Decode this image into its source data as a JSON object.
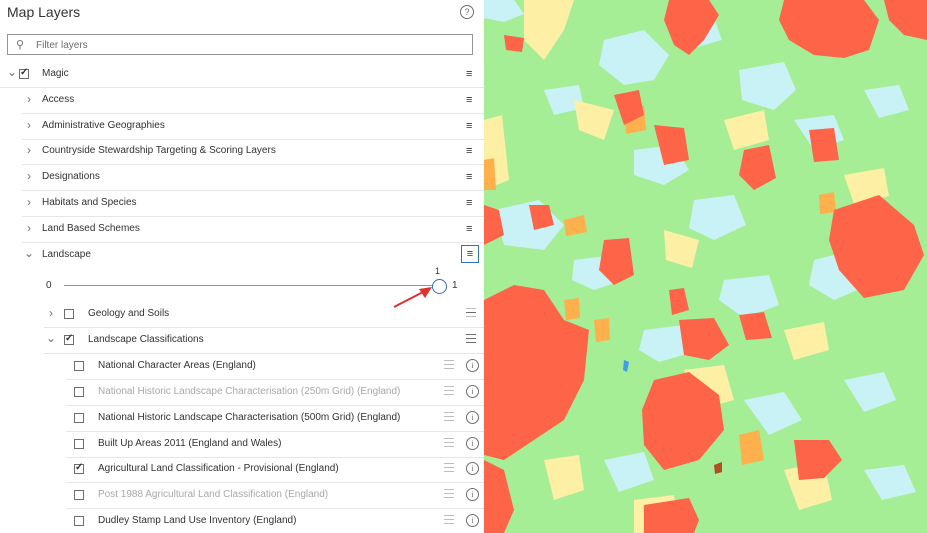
{
  "panel": {
    "title": "Map Layers",
    "help_glyph": "?",
    "filter": {
      "placeholder": "Filter layers",
      "value": ""
    }
  },
  "icons": {
    "expanded": "chevron-down-icon",
    "collapsed": "chevron-right-icon",
    "options": "sliders-icon",
    "legend": "list-icon",
    "info": "info-icon",
    "search": "search-icon"
  },
  "rows": [
    {
      "label": "Magic",
      "level": 0,
      "expand": "down",
      "check": true,
      "action": "options"
    },
    {
      "label": "Access",
      "level": 1,
      "expand": "right",
      "action": "options"
    },
    {
      "label": "Administrative Geographies",
      "level": 1,
      "expand": "right",
      "action": "options"
    },
    {
      "label": "Countryside Stewardship Targeting & Scoring Layers",
      "level": 1,
      "expand": "right",
      "action": "options"
    },
    {
      "label": "Designations",
      "level": 1,
      "expand": "right",
      "action": "options"
    },
    {
      "label": "Habitats and Species",
      "level": 1,
      "expand": "right",
      "action": "options"
    },
    {
      "label": "Land Based Schemes",
      "level": 1,
      "expand": "right",
      "action": "options"
    },
    {
      "label": "Landscape",
      "level": 1,
      "expand": "down",
      "action": "options",
      "active": true
    }
  ],
  "slider": {
    "min": "0",
    "max": "1",
    "value": "1"
  },
  "sub_rows": [
    {
      "label": "Geology and Soils",
      "level": 2,
      "expand": "right",
      "check": false,
      "action": "legend-light"
    },
    {
      "label": "Landscape Classifications",
      "level": 2,
      "expand": "down",
      "check": true,
      "action": "legend"
    },
    {
      "label": "National Character Areas (England)",
      "level": 3,
      "check": false,
      "dim": false
    },
    {
      "label": "National Historic Landscape Characterisation (250m Grid) (England)",
      "level": 3,
      "check": false,
      "dim": true
    },
    {
      "label": "National Historic Landscape Characterisation (500m Grid) (England)",
      "level": 3,
      "check": false,
      "dim": false
    },
    {
      "label": "Built Up Areas 2011 (England and Wales)",
      "level": 3,
      "check": false,
      "dim": false
    },
    {
      "label": "Agricultural Land Classification - Provisional (England)",
      "level": 3,
      "check": true,
      "dim": false
    },
    {
      "label": "Post 1988 Agricultural Land Classification (England)",
      "level": 3,
      "check": false,
      "dim": true
    },
    {
      "label": "Dudley Stamp Land Use Inventory (England)",
      "level": 3,
      "check": false,
      "dim": false
    }
  ],
  "colors": {
    "map_background": "#a5ee95",
    "water": "#c9f2f7",
    "sand": "#fdf0a4",
    "urban": "#fd6448",
    "orange": "#fdb04b",
    "accent": "#2f6fbf",
    "annotation_arrow": "#e03030"
  }
}
